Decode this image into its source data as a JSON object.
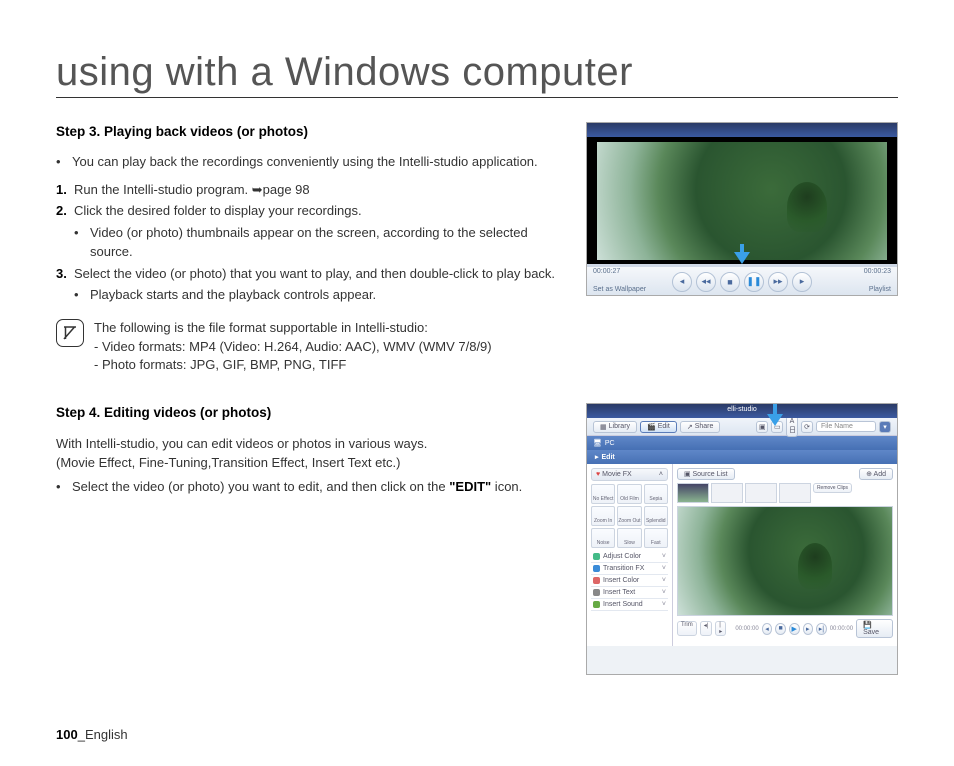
{
  "title": "using with a Windows computer",
  "step3": {
    "heading": "Step 3. Playing back videos (or photos)",
    "bullet1": "You can play back the recordings conveniently using the Intelli-studio application.",
    "n1": "Run the Intelli-studio program. ➥page 98",
    "n2": "Click the desired folder to display your recordings.",
    "n2_sub": "Video (or photo) thumbnails appear on the screen, according to the selected source.",
    "n3": "Select the video (or photo) that you want to play, and then double-click to play back.",
    "n3_sub": "Playback starts and the playback controls appear.",
    "note_intro": "The following is the file format supportable in Intelli-studio:",
    "note_video": "-  Video formats: MP4 (Video: H.264, Audio: AAC), WMV (WMV 7/8/9)",
    "note_photo": "-  Photo formats: JPG, GIF, BMP, PNG, TIFF"
  },
  "step4": {
    "heading": "Step 4. Editing videos (or photos)",
    "intro1": "With Intelli-studio, you can edit videos or photos in various ways.",
    "intro2": "(Movie Effect, Fine-Tuning,Transition Effect, Insert Text etc.)",
    "bullet_pre": "Select the video (or photo) you want to edit, and then click on the ",
    "bullet_em": "\"EDIT\"",
    "bullet_post": " icon."
  },
  "player": {
    "time_left": "00:00:27",
    "time_right": "00:00:23",
    "wallpaper": "Set as Wallpaper",
    "playlist": "Playlist"
  },
  "editor": {
    "app_title": "elli-studio",
    "tabs": {
      "library": "Library",
      "edit": "Edit",
      "share": "Share"
    },
    "search_placeholder": "File Name",
    "pc": "PC",
    "edit_label": "Edit",
    "movie_fx": "Movie FX",
    "fx_cells": [
      "No Effect",
      "Old Film",
      "Sepia",
      "Zoom In",
      "Zoom Out",
      "Splendid",
      "Noise",
      "Slow",
      "Fast"
    ],
    "fx_list": [
      "Adjust Color",
      "Transition FX",
      "Insert Color",
      "Insert Text",
      "Insert Sound"
    ],
    "source_list": "Source List",
    "add": "Add",
    "remove": "Remove Clips",
    "trim": "Trim",
    "save": "Save",
    "t_left": "00:00:00",
    "t_right": "00:00:00"
  },
  "footer": {
    "page": "100",
    "sep": "_",
    "lang": "English"
  }
}
